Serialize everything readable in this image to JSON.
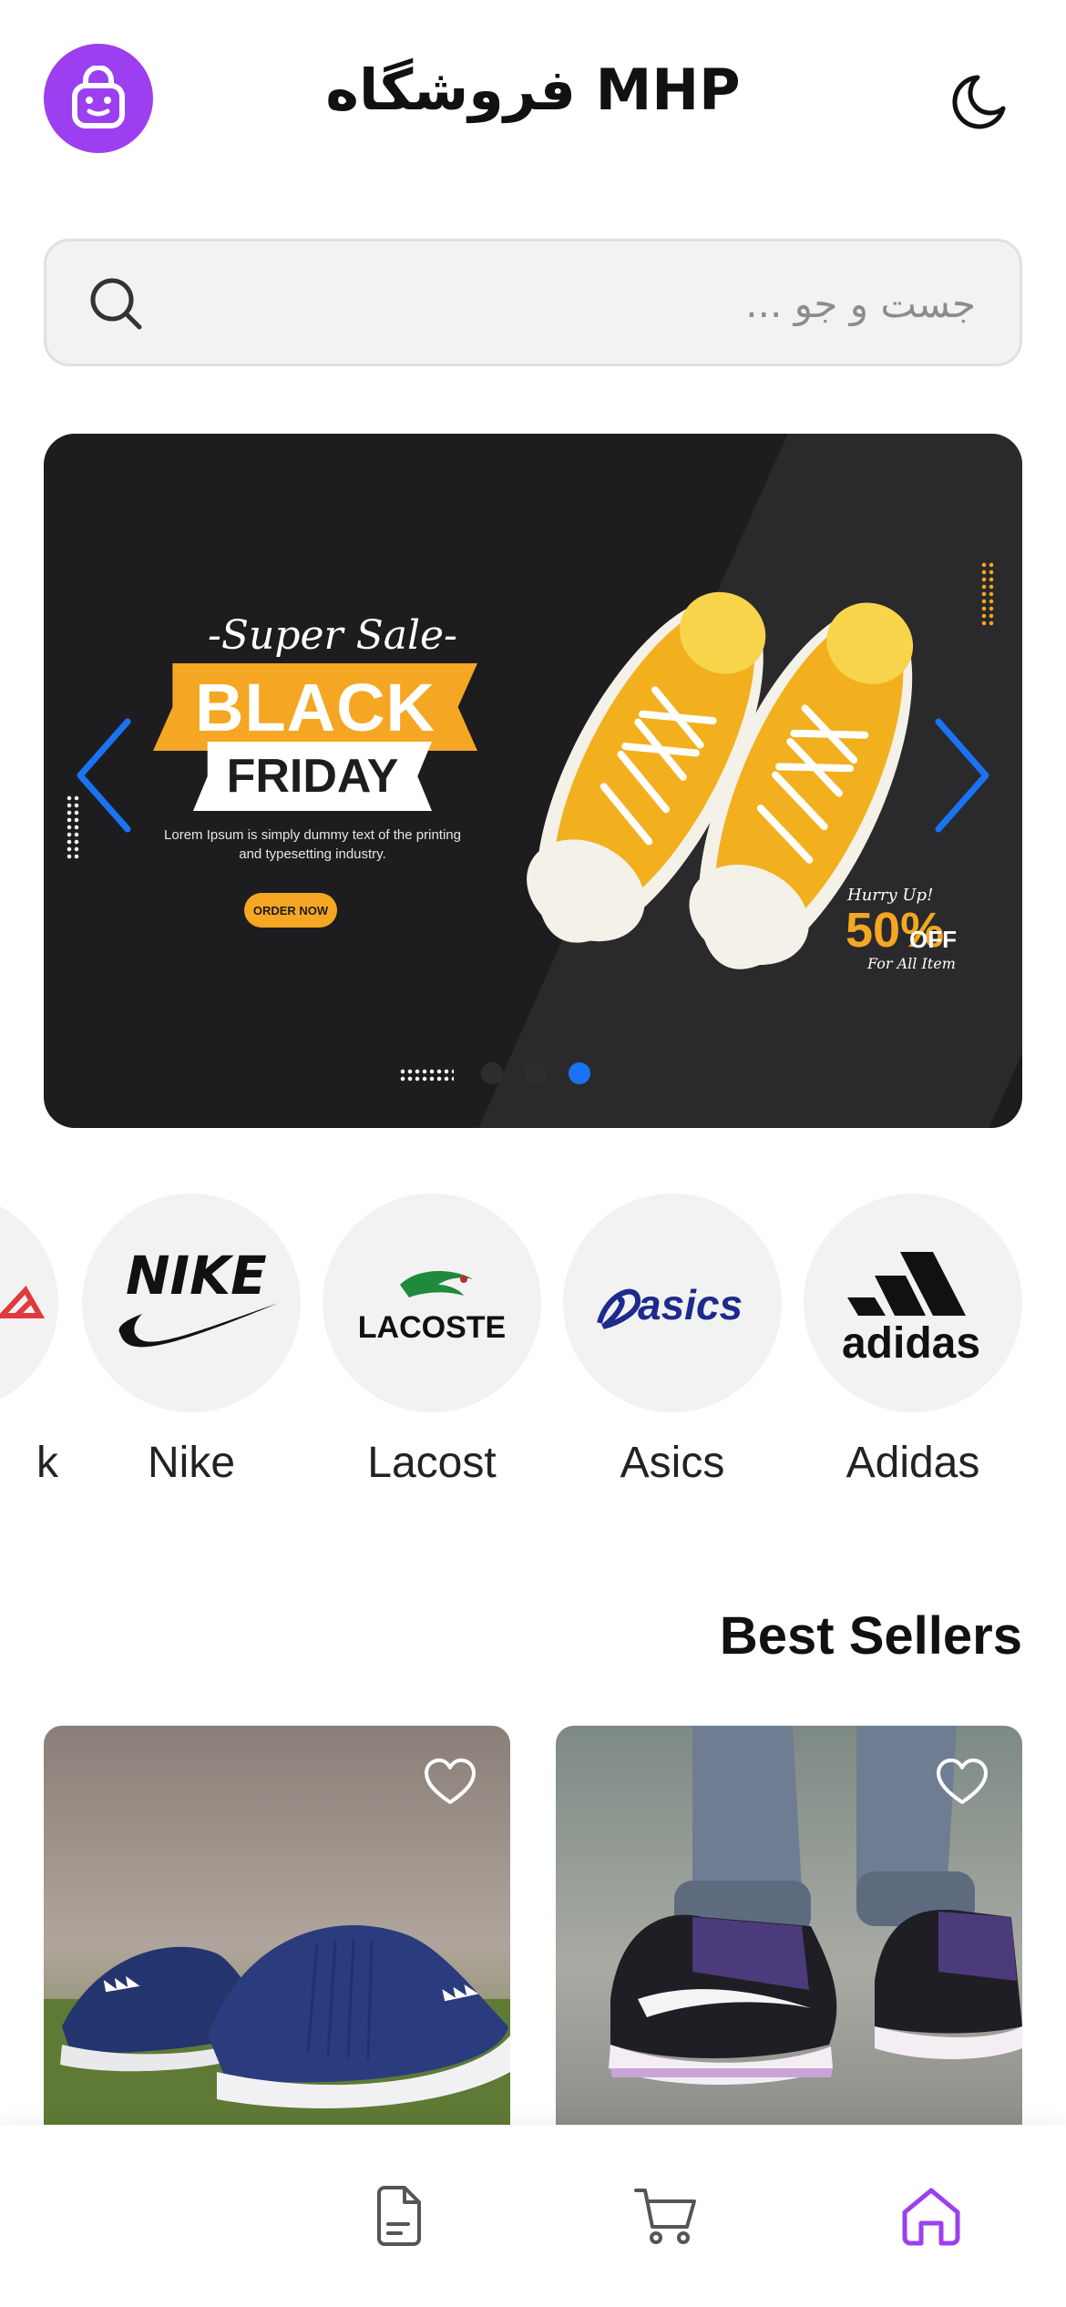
{
  "header": {
    "title": "فروشگاه MHP",
    "logo_icon": "shopping-bag-icon",
    "theme_icon": "moon-icon",
    "accent": "#9b3ff0"
  },
  "search": {
    "placeholder": "جست و جو ...",
    "value": "",
    "icon": "search-icon"
  },
  "banner": {
    "super_sale": "-Super Sale-",
    "line1": "BLACK",
    "line2": "FRIDAY",
    "description": "Lorem Ipsum is simply dummy text of the printing and typesetting industry.",
    "cta": "ORDER NOW",
    "hurry": "Hurry Up!",
    "discount": "50%",
    "off": "OFF",
    "for_all": "For All Item",
    "slides": 3,
    "active_slide": 3,
    "accent": "#f5a623",
    "pager_active_color": "#1a73f2"
  },
  "brands": [
    {
      "label": "k",
      "logo": "reebok-logo"
    },
    {
      "label": "Nike",
      "logo": "nike-logo"
    },
    {
      "label": "Lacost",
      "logo": "lacoste-logo",
      "logo_text": "LACOSTE"
    },
    {
      "label": "Asics",
      "logo": "asics-logo",
      "logo_text": "asics"
    },
    {
      "label": "Adidas",
      "logo": "adidas-logo",
      "logo_text": "adidas"
    }
  ],
  "best_sellers": {
    "title": "Best Sellers",
    "products": [
      {
        "image": "blue-adidas-sneakers",
        "favorite": false
      },
      {
        "image": "purple-jordan-sneakers",
        "favorite": false
      }
    ]
  },
  "bottom_nav": {
    "items": [
      {
        "icon": "document-icon",
        "active": false
      },
      {
        "icon": "cart-icon",
        "active": false
      },
      {
        "icon": "home-icon",
        "active": true
      }
    ],
    "active_color": "#9b3ff0"
  }
}
